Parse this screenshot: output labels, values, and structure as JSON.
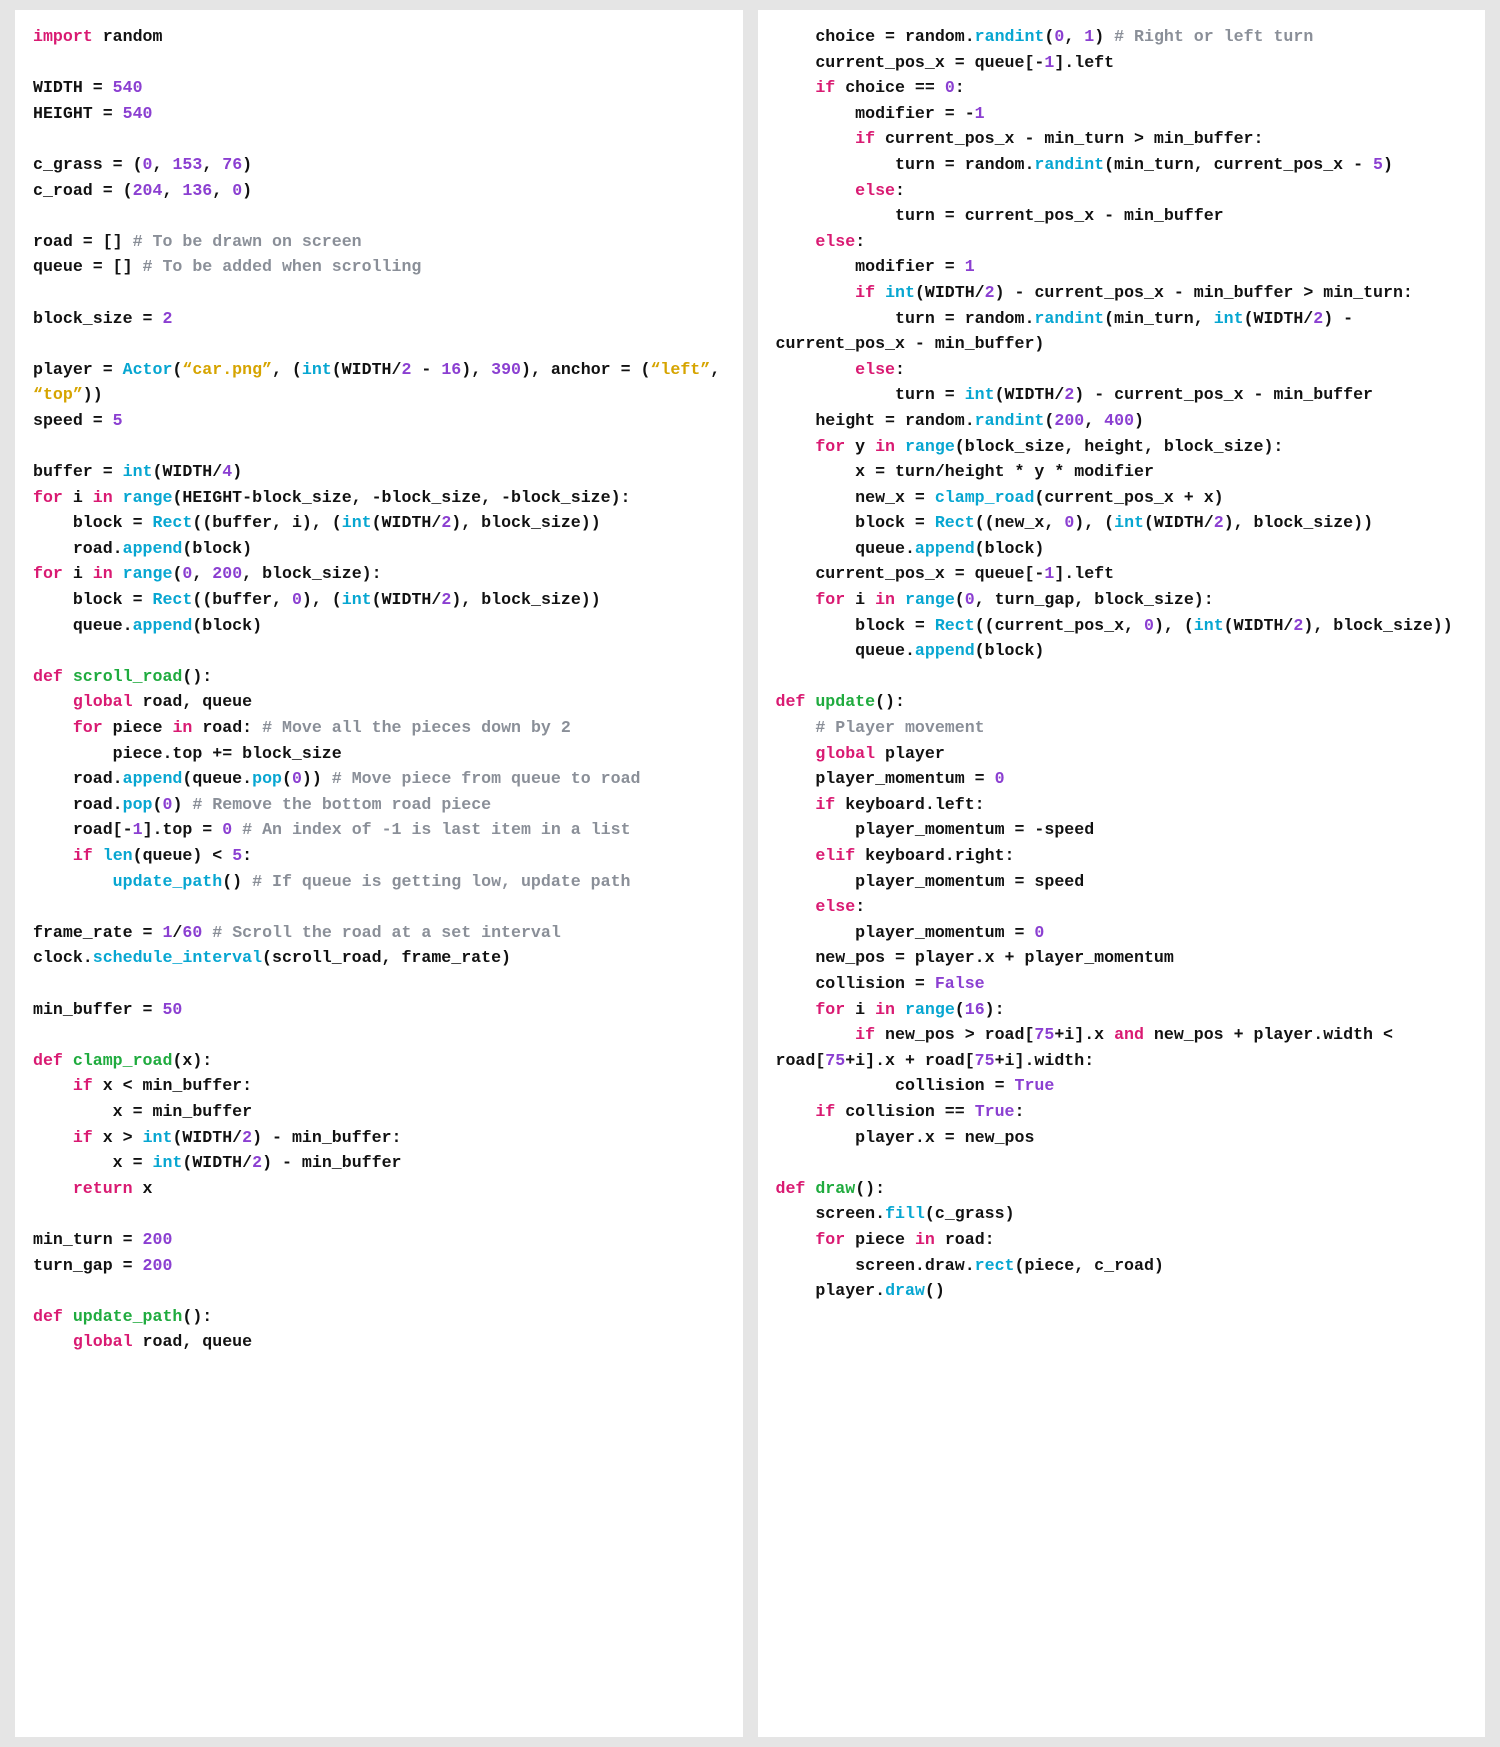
{
  "left_code_html": "<span class=\"k\">import</span> random\n\nWIDTH = <span class=\"n\">540</span>\nHEIGHT = <span class=\"n\">540</span>\n\nc_grass = (<span class=\"n\">0</span>, <span class=\"n\">153</span>, <span class=\"n\">76</span>)\nc_road = (<span class=\"n\">204</span>, <span class=\"n\">136</span>, <span class=\"n\">0</span>)\n\nroad = [] <span class=\"c\"># To be drawn on screen</span>\nqueue = [] <span class=\"c\"># To be added when scrolling</span>\n\nblock_size = <span class=\"n\">2</span>\n\nplayer = <span class=\"bi\">Actor</span>(<span class=\"s\">“car.png”</span>, (<span class=\"bi\">int</span>(WIDTH/<span class=\"n\">2</span> - <span class=\"n\">16</span>), <span class=\"n\">390</span>), anchor = (<span class=\"s\">“left”</span>, <span class=\"s\">“top”</span>))\nspeed = <span class=\"n\">5</span>\n\nbuffer = <span class=\"bi\">int</span>(WIDTH/<span class=\"n\">4</span>)\n<span class=\"k\">for</span> i <span class=\"k\">in</span> <span class=\"bi\">range</span>(HEIGHT-block_size, -block_size, -block_size):\n    block = <span class=\"bi\">Rect</span>((buffer, i), (<span class=\"bi\">int</span>(WIDTH/<span class=\"n\">2</span>), block_size))\n    road.<span class=\"fnc\">append</span>(block)\n<span class=\"k\">for</span> i <span class=\"k\">in</span> <span class=\"bi\">range</span>(<span class=\"n\">0</span>, <span class=\"n\">200</span>, block_size):\n    block = <span class=\"bi\">Rect</span>((buffer, <span class=\"n\">0</span>), (<span class=\"bi\">int</span>(WIDTH/<span class=\"n\">2</span>), block_size))\n    queue.<span class=\"fnc\">append</span>(block)\n\n<span class=\"k\">def</span> <span class=\"fn\">scroll_road</span>():\n    <span class=\"k\">global</span> road, queue\n    <span class=\"k\">for</span> piece <span class=\"k\">in</span> road: <span class=\"c\"># Move all the pieces down by 2</span>\n        piece.top += block_size\n    road.<span class=\"fnc\">append</span>(queue.<span class=\"fnc\">pop</span>(<span class=\"n\">0</span>)) <span class=\"c\"># Move piece from queue to road</span>\n    road.<span class=\"fnc\">pop</span>(<span class=\"n\">0</span>) <span class=\"c\"># Remove the bottom road piece</span>\n    road[-<span class=\"n\">1</span>].top = <span class=\"n\">0</span> <span class=\"c\"># An index of -1 is last item in a list</span>\n    <span class=\"k\">if</span> <span class=\"bi\">len</span>(queue) &lt; <span class=\"n\">5</span>:\n        <span class=\"fnc\">update_path</span>() <span class=\"c\"># If queue is getting low, update path</span>\n\nframe_rate = <span class=\"n\">1</span>/<span class=\"n\">60</span> <span class=\"c\"># Scroll the road at a set interval</span>\nclock.<span class=\"fnc\">schedule_interval</span>(scroll_road, frame_rate)\n\nmin_buffer = <span class=\"n\">50</span>\n\n<span class=\"k\">def</span> <span class=\"fn\">clamp_road</span>(x):\n    <span class=\"k\">if</span> x &lt; min_buffer:\n        x = min_buffer\n    <span class=\"k\">if</span> x &gt; <span class=\"bi\">int</span>(WIDTH/<span class=\"n\">2</span>) - min_buffer:\n        x = <span class=\"bi\">int</span>(WIDTH/<span class=\"n\">2</span>) - min_buffer\n    <span class=\"k\">return</span> x\n\nmin_turn = <span class=\"n\">200</span>\nturn_gap = <span class=\"n\">200</span>\n\n<span class=\"k\">def</span> <span class=\"fn\">update_path</span>():\n    <span class=\"k\">global</span> road, queue",
  "right_code_html": "    choice = random.<span class=\"fnc\">randint</span>(<span class=\"n\">0</span>, <span class=\"n\">1</span>) <span class=\"c\"># Right or left turn</span>\n    current_pos_x = queue[-<span class=\"n\">1</span>].left\n    <span class=\"k\">if</span> choice == <span class=\"n\">0</span>:\n        modifier = -<span class=\"n\">1</span>\n        <span class=\"k\">if</span> current_pos_x - min_turn &gt; min_buffer:\n            turn = random.<span class=\"fnc\">randint</span>(min_turn, current_pos_x - <span class=\"n\">5</span>)\n        <span class=\"k\">else</span>:\n            turn = current_pos_x - min_buffer\n    <span class=\"k\">else</span>:\n        modifier = <span class=\"n\">1</span>\n        <span class=\"k\">if</span> <span class=\"bi\">int</span>(WIDTH/<span class=\"n\">2</span>) - current_pos_x - min_buffer &gt; min_turn:\n            turn = random.<span class=\"fnc\">randint</span>(min_turn, <span class=\"bi\">int</span>(WIDTH/<span class=\"n\">2</span>) - current_pos_x - min_buffer)\n        <span class=\"k\">else</span>:\n            turn = <span class=\"bi\">int</span>(WIDTH/<span class=\"n\">2</span>) - current_pos_x - min_buffer\n    height = random.<span class=\"fnc\">randint</span>(<span class=\"n\">200</span>, <span class=\"n\">400</span>)\n    <span class=\"k\">for</span> y <span class=\"k\">in</span> <span class=\"bi\">range</span>(block_size, height, block_size):\n        x = turn/height * y * modifier\n        new_x = <span class=\"fnc\">clamp_road</span>(current_pos_x + x)\n        block = <span class=\"bi\">Rect</span>((new_x, <span class=\"n\">0</span>), (<span class=\"bi\">int</span>(WIDTH/<span class=\"n\">2</span>), block_size))\n        queue.<span class=\"fnc\">append</span>(block)\n    current_pos_x = queue[-<span class=\"n\">1</span>].left\n    <span class=\"k\">for</span> i <span class=\"k\">in</span> <span class=\"bi\">range</span>(<span class=\"n\">0</span>, turn_gap, block_size):\n        block = <span class=\"bi\">Rect</span>((current_pos_x, <span class=\"n\">0</span>), (<span class=\"bi\">int</span>(WIDTH/<span class=\"n\">2</span>), block_size))\n        queue.<span class=\"fnc\">append</span>(block)\n\n<span class=\"k\">def</span> <span class=\"fn\">update</span>():\n    <span class=\"c\"># Player movement</span>\n    <span class=\"k\">global</span> player\n    player_momentum = <span class=\"n\">0</span>\n    <span class=\"k\">if</span> keyboard.left:\n        player_momentum = -speed\n    <span class=\"k\">elif</span> keyboard.right:\n        player_momentum = speed\n    <span class=\"k\">else</span>:\n        player_momentum = <span class=\"n\">0</span>\n    new_pos = player.x + player_momentum\n    collision = <span class=\"bool\">False</span>\n    <span class=\"k\">for</span> i <span class=\"k\">in</span> <span class=\"bi\">range</span>(<span class=\"n\">16</span>):\n        <span class=\"k\">if</span> new_pos &gt; road[<span class=\"n\">75</span>+i].x <span class=\"k\">and</span> new_pos + player.width &lt; road[<span class=\"n\">75</span>+i].x + road[<span class=\"n\">75</span>+i].width:\n            collision = <span class=\"bool\">True</span>\n    <span class=\"k\">if</span> collision == <span class=\"bool\">True</span>:\n        player.x = new_pos\n\n<span class=\"k\">def</span> <span class=\"fn\">draw</span>():\n    screen.<span class=\"fnc\">fill</span>(c_grass)\n    <span class=\"k\">for</span> piece <span class=\"k\">in</span> road:\n        screen.draw.<span class=\"fnc\">rect</span>(piece, c_road)\n    player.<span class=\"fnc\">draw</span>()"
}
